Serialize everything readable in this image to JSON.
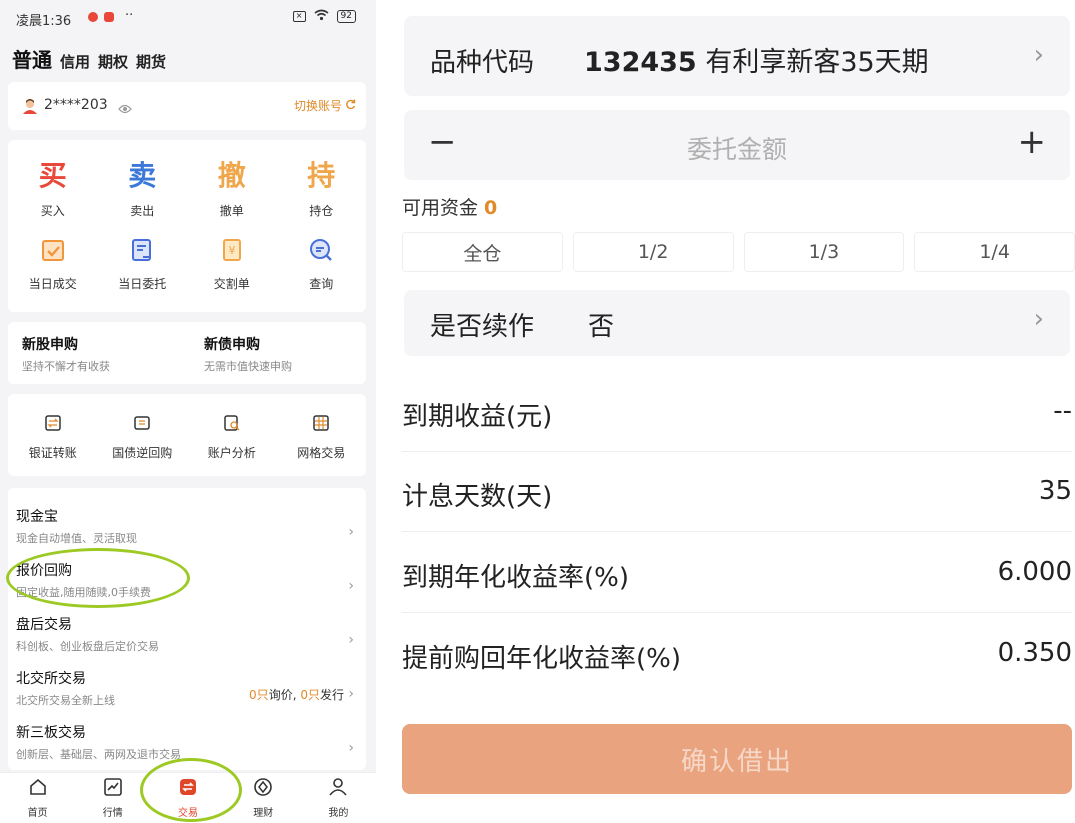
{
  "status_bar": {
    "time": "凌晨1:36",
    "dots": "··",
    "battery": "92"
  },
  "account_tabs": {
    "active": "普通",
    "others": [
      "信用",
      "期权",
      "期货"
    ]
  },
  "user": {
    "id": "2****203",
    "switch_label": "切换账号"
  },
  "trade_grid": [
    {
      "char": "买",
      "label": "买入",
      "color": "#e8473a"
    },
    {
      "char": "卖",
      "label": "卖出",
      "color": "#3b78d8"
    },
    {
      "char": "撤",
      "label": "撤单",
      "color": "#f0a64a"
    },
    {
      "char": "持",
      "label": "持仓",
      "color": "#f0a64a"
    }
  ],
  "query_grid": [
    {
      "icon": "calendar-check-icon",
      "label": "当日成交",
      "color": "#f0963c"
    },
    {
      "icon": "order-doc-icon",
      "label": "当日委托",
      "color": "#4a6fd8"
    },
    {
      "icon": "receipt-icon",
      "label": "交割单",
      "color": "#f0a64a"
    },
    {
      "icon": "search-doc-icon",
      "label": "查询",
      "color": "#4a6fd8"
    }
  ],
  "promos": [
    {
      "title": "新股申购",
      "subtitle": "坚持不懈才有收获"
    },
    {
      "title": "新债申购",
      "subtitle": "无需市值快速申购"
    }
  ],
  "tools": [
    {
      "icon": "bank-transfer-icon",
      "label": "银证转账"
    },
    {
      "icon": "bond-repo-icon",
      "label": "国债逆回购"
    },
    {
      "icon": "account-analysis-icon",
      "label": "账户分析"
    },
    {
      "icon": "grid-trade-icon",
      "label": "网格交易"
    }
  ],
  "list": [
    {
      "title": "现金宝",
      "subtitle": "现金自动增值、灵活取现"
    },
    {
      "title": "报价回购",
      "subtitle": "固定收益,随用随赎,0手续费"
    },
    {
      "title": "盘后交易",
      "subtitle": "科创板、创业板盘后定价交易"
    },
    {
      "title": "北交所交易",
      "subtitle": "北交所交易全新上线",
      "extra": {
        "n1": "0只",
        "t1": "询价,",
        "n2": "0只",
        "t2": "发行"
      }
    },
    {
      "title": "新三板交易",
      "subtitle": "创新层、基础层、两网及退市交易"
    }
  ],
  "bottom_nav": [
    "首页",
    "行情",
    "交易",
    "理财",
    "我的"
  ],
  "order": {
    "code_label": "品种代码",
    "code": "132435",
    "product_name": "有利享新客35天期",
    "amount_placeholder": "委托金额",
    "minus": "−",
    "plus": "+",
    "available_label": "可用资金",
    "available_value": "0",
    "ratios": [
      "全仓",
      "1/2",
      "1/3",
      "1/4"
    ],
    "renew_label": "是否续作",
    "renew_value": "否",
    "info": [
      {
        "key": "到期收益(元)",
        "value": "--"
      },
      {
        "key": "计息天数(天)",
        "value": "35"
      },
      {
        "key": "到期年化收益率(%)",
        "value": "6.000"
      },
      {
        "key": "提前购回年化收益率(%)",
        "value": "0.350"
      }
    ],
    "confirm_label": "确认借出"
  },
  "colors": {
    "accent_orange": "#e08a2a",
    "button": "#e9a37f",
    "highlight_oval": "#9cc923",
    "nav_active": "#e0462a"
  }
}
